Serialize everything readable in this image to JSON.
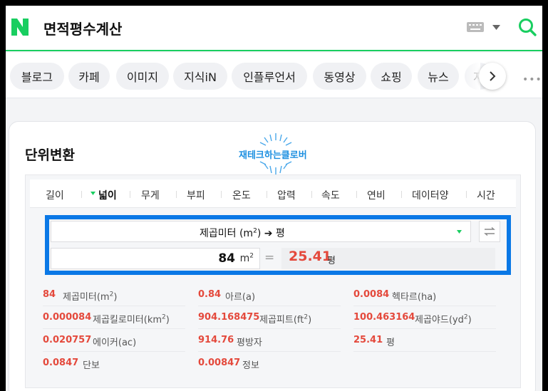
{
  "header": {
    "query": "면적평수계산",
    "logo_letter": "N"
  },
  "tabs": [
    {
      "label": "블로그"
    },
    {
      "label": "카페"
    },
    {
      "label": "이미지"
    },
    {
      "label": "지식iN"
    },
    {
      "label": "인플루언서"
    },
    {
      "label": "동영상"
    },
    {
      "label": "쇼핑"
    },
    {
      "label": "뉴스"
    },
    {
      "label": "지"
    }
  ],
  "more_label": "•••",
  "card": {
    "title": "단위변환",
    "watermark": "재테크하는클로버"
  },
  "unit_tabs": [
    {
      "label": "길이"
    },
    {
      "label": "넓이",
      "active": true
    },
    {
      "label": "무게"
    },
    {
      "label": "부피"
    },
    {
      "label": "온도"
    },
    {
      "label": "압력"
    },
    {
      "label": "속도"
    },
    {
      "label": "연비"
    },
    {
      "label": "데이터양"
    },
    {
      "label": "시간"
    }
  ],
  "converter": {
    "selection_from": "제곱미터 (m",
    "selection_from_sup": "2",
    "selection_from_close": ")",
    "arrow": "➔",
    "selection_to": "평",
    "input_value": "84",
    "input_unit": "m",
    "input_unit_sup": "2",
    "equals": "=",
    "result_value": "25.41",
    "result_unit": "평"
  },
  "results": [
    {
      "value": "84",
      "unit": "제곱미터(m",
      "sup": "2",
      "close": ")"
    },
    {
      "value": "0.84",
      "unit": "아르(a)"
    },
    {
      "value": "0.0084",
      "unit": "헥타르(ha)"
    },
    {
      "value": "0.000084",
      "unit": "제곱킬로미터(km",
      "sup": "2",
      "close": ")"
    },
    {
      "value": "904.168475",
      "unit": "제곱피트(ft",
      "sup": "2",
      "close": ")"
    },
    {
      "value": "100.463164",
      "unit": "제곱야드(yd",
      "sup": "2",
      "close": ")"
    },
    {
      "value": "0.020757",
      "unit": "에이커(ac)"
    },
    {
      "value": "914.76",
      "unit": "평방자"
    },
    {
      "value": "25.41",
      "unit": "평"
    },
    {
      "value": "0.0847",
      "unit": "단보"
    },
    {
      "value": "0.00847",
      "unit": "정보"
    }
  ],
  "colors": {
    "brand_green": "#19ce60",
    "accent_blue": "#0a78e6",
    "result_red": "#e4493c"
  }
}
